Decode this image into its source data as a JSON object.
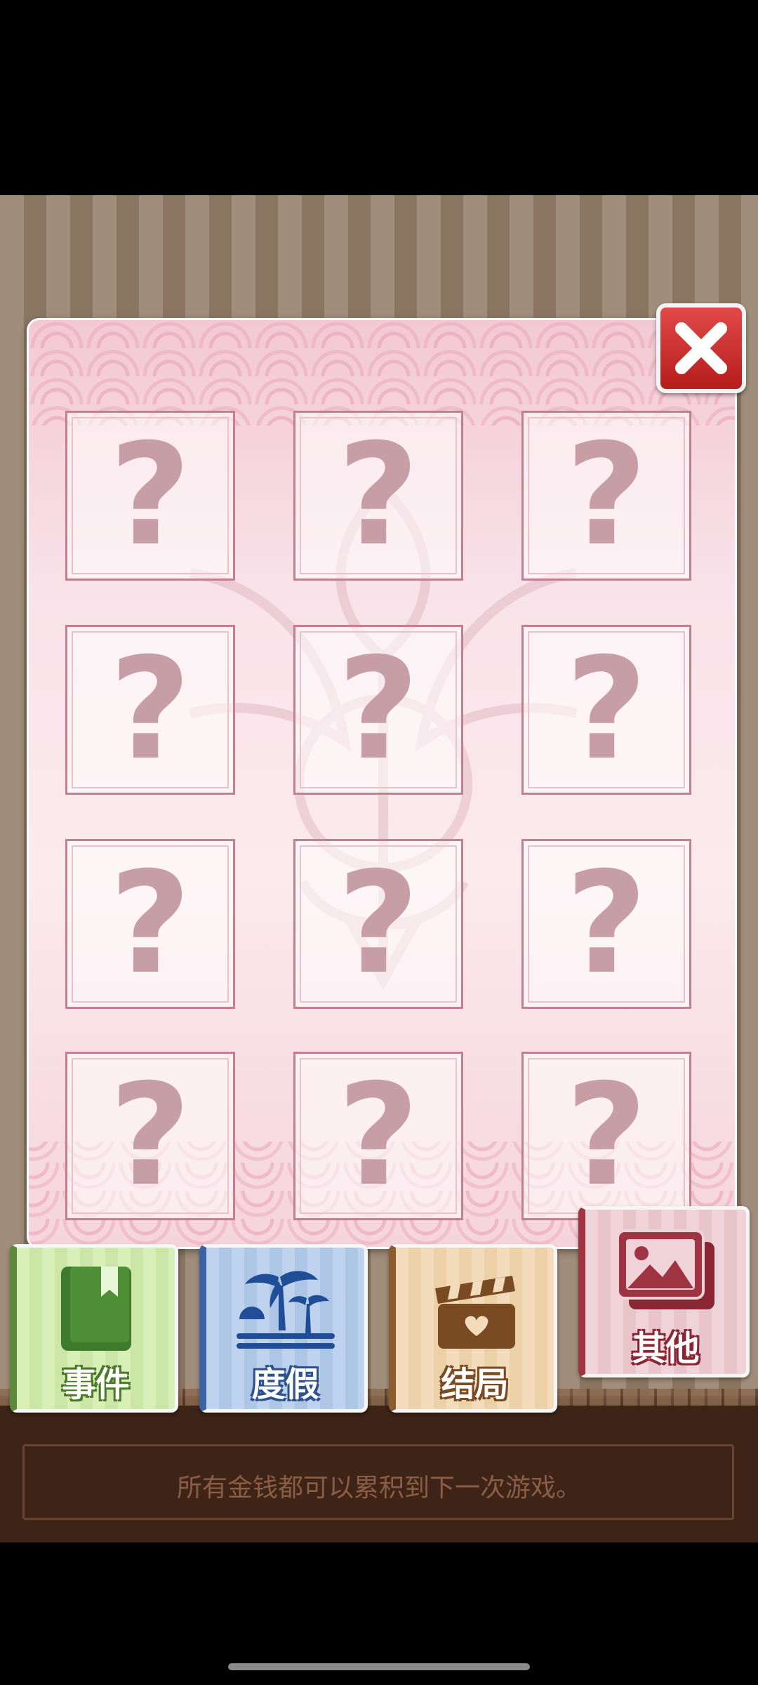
{
  "gallery": {
    "tiles": [
      {
        "symbol": "?"
      },
      {
        "symbol": "?"
      },
      {
        "symbol": "?"
      },
      {
        "symbol": "?"
      },
      {
        "symbol": "?"
      },
      {
        "symbol": "?"
      },
      {
        "symbol": "?"
      },
      {
        "symbol": "?"
      },
      {
        "symbol": "?"
      },
      {
        "symbol": "?"
      },
      {
        "symbol": "?"
      },
      {
        "symbol": "?"
      }
    ]
  },
  "close_button": {
    "icon": "close-icon"
  },
  "tabs": [
    {
      "label": "事件",
      "icon": "book-bookmark-icon",
      "color": "#5d8a3a"
    },
    {
      "label": "度假",
      "icon": "palm-tree-icon",
      "color": "#3b63a3"
    },
    {
      "label": "结局",
      "icon": "clapperboard-heart-icon",
      "color": "#8a5c30"
    },
    {
      "label": "其他",
      "icon": "picture-gallery-icon",
      "color": "#9e3442",
      "selected": true
    }
  ],
  "footer": {
    "message": "所有金钱都可以累积到下一次游戏。"
  }
}
